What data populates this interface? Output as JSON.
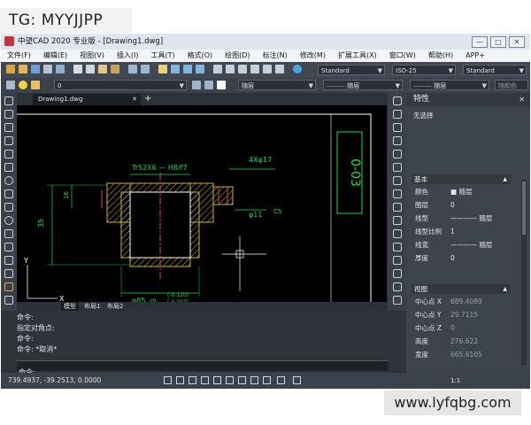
{
  "watermark_top": "TG: MYYJJPP",
  "watermark_bottom": "www.lyfqbg.com",
  "window": {
    "title": "中望CAD 2020 专业版 - [Drawing1.dwg]",
    "buttons": [
      "—",
      "□",
      "✕"
    ]
  },
  "menu": [
    "文件(F)",
    "编辑(E)",
    "视图(V)",
    "插入(I)",
    "工具(T)",
    "格式(O)",
    "绘图(D)",
    "标注(N)",
    "修改(M)",
    "扩展工具(X)",
    "窗口(W)",
    "帮助(H)",
    "APP+"
  ],
  "toolbar": {
    "text_style": "Standard",
    "dim_style": "ISO-25",
    "table_style": "Standard",
    "layer": "0",
    "color": "随层",
    "linetype": "随层",
    "lineweight": "随层",
    "plot_style": "随颜色"
  },
  "doc_tab": {
    "label": "Drawing1.dwg",
    "close": "✕",
    "add": "+"
  },
  "layout_tabs": [
    "模型",
    "布局1",
    "布局2"
  ],
  "drawing": {
    "thread_label": "Tr52X6 — H8/f7",
    "hole_label": "4Xφ17",
    "dia_label": "φ11",
    "small_label": "C5",
    "dim_vert": "35",
    "dim_left": "16",
    "dim_bottom_main": "φ85",
    "dim_bottom_fit": "d9",
    "tol_upper": "(-0.120)",
    "tol_lower": "(-0.207)",
    "title_text": "0-03",
    "axis_y": "Y",
    "axis_x": "X"
  },
  "properties": {
    "header": "特性",
    "close": "✕",
    "selection": "无选择",
    "section_basic": "基本",
    "basic": [
      {
        "key": "颜色",
        "value": "■ 随层"
      },
      {
        "key": "图层",
        "value": "0"
      },
      {
        "key": "线型",
        "value": "———— 随层"
      },
      {
        "key": "线型比例",
        "value": "1"
      },
      {
        "key": "线宽",
        "value": "———— 随层"
      },
      {
        "key": "厚度",
        "value": "0"
      }
    ],
    "section_view": "视图",
    "view": [
      {
        "key": "中心点 X",
        "value": "689.4089"
      },
      {
        "key": "中心点 Y",
        "value": "29.7115"
      },
      {
        "key": "中心点 Z",
        "value": "0"
      },
      {
        "key": "高度",
        "value": "276.622"
      },
      {
        "key": "宽度",
        "value": "665.6105"
      }
    ]
  },
  "command": {
    "history": [
      "命令:",
      "指定对角点:",
      "命令:",
      "命令: *取消*"
    ],
    "prompt": "命令:"
  },
  "status": {
    "coords": "739.4937, -39.2513, 0.0000",
    "scale": "1:1"
  }
}
